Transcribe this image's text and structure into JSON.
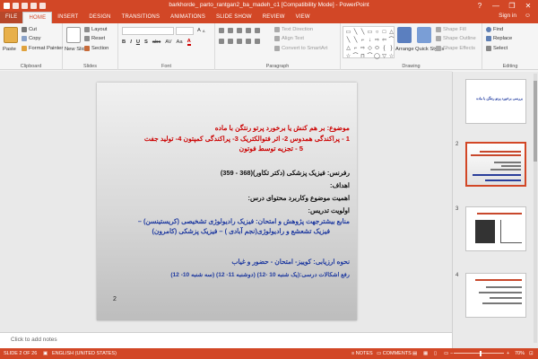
{
  "window": {
    "title": "barkhorde_ parto_rantgan2_ba_madeh_c1 [Compatibility Mode] - PowerPoint",
    "sign_in": "Sign in",
    "controls": [
      "?",
      "—",
      "❐",
      "✕"
    ]
  },
  "tabs": [
    "FILE",
    "HOME",
    "INSERT",
    "DESIGN",
    "TRANSITIONS",
    "ANIMATIONS",
    "SLIDE SHOW",
    "REVIEW",
    "VIEW"
  ],
  "ribbon": {
    "clipboard": {
      "paste": "Paste",
      "cut": "Cut",
      "copy": "Copy",
      "format_painter": "Format Painter",
      "label": "Clipboard"
    },
    "slides": {
      "new_slide": "New Slide",
      "layout": "Layout",
      "reset": "Reset",
      "section": "Section",
      "label": "Slides"
    },
    "font": {
      "label": "Font",
      "buttons": [
        "B",
        "I",
        "U",
        "S",
        "abc",
        "AV",
        "Aa",
        "A"
      ]
    },
    "paragraph": {
      "text_direction": "Text Direction",
      "align_text": "Align Text",
      "convert_smartart": "Convert to SmartArt",
      "label": "Paragraph"
    },
    "drawing": {
      "arrange": "Arrange",
      "quick_styles": "Quick Styles",
      "shape_fill": "Shape Fill",
      "shape_outline": "Shape Outline",
      "shape_effects": "Shape Effects",
      "label": "Drawing",
      "shapes": [
        "▭",
        "╲",
        "╲",
        "▭",
        "○",
        "□",
        "△",
        "╲",
        "╲",
        "⌐",
        "↓",
        "⇨",
        "⇦",
        "⌒",
        "△",
        "⌐",
        "⇨",
        "◇",
        "⬭",
        "{",
        "}",
        "☆",
        "⌒",
        "⊓",
        "⌒",
        "◯",
        "▽",
        "☆"
      ]
    },
    "editing": {
      "find": "Find",
      "replace": "Replace",
      "select": "Select",
      "label": "Editing"
    }
  },
  "slide": {
    "lines": [
      "موضوع: بر هم کنش یا برخورد پرتو رنتگن با ماده",
      "1 - پراکندگی همدوس   2- اثر فتوالکتریک   3- پراکندگی کمپتون  4- تولید جفت",
      "5 - تجزیه توسط فوتون",
      "رفرنس: فیزیک پزشکی (دکتر تکاور)(368 - 359)",
      "اهداف:",
      "اهمیت موضوع وکاربرد محتوای درس:",
      "اولویت تدریس:",
      "منابع بیشترجهت پژوهش و امتحان: فیزیک رادیولوژی تشخیصی (کریستینسن) –",
      "فیزیک تشعشع و رادیولوژی(نجم آبادی ) – فیزیک پزشکی (کامرون)",
      "نحوه ارزیابی: کوییز- امتحان - حضور و غیاب",
      "رفع اشکالات درسی:(یک شنبه 10 -12) (دوشنبه 11- 12) (سه شنبه 10- 12)"
    ],
    "page_number": "2"
  },
  "thumbnails": [
    {
      "num": "",
      "title": "بررسی برخورد پرتو رنتگن با ماده"
    },
    {
      "num": "2"
    },
    {
      "num": "3"
    },
    {
      "num": "4"
    }
  ],
  "notes_placeholder": "Click to add notes",
  "status": {
    "slide": "SLIDE 2 OF 26",
    "language": "ENGLISH (UNITED STATES)",
    "notes": "NOTES",
    "comments": "COMMENTS",
    "zoom": "70%"
  }
}
